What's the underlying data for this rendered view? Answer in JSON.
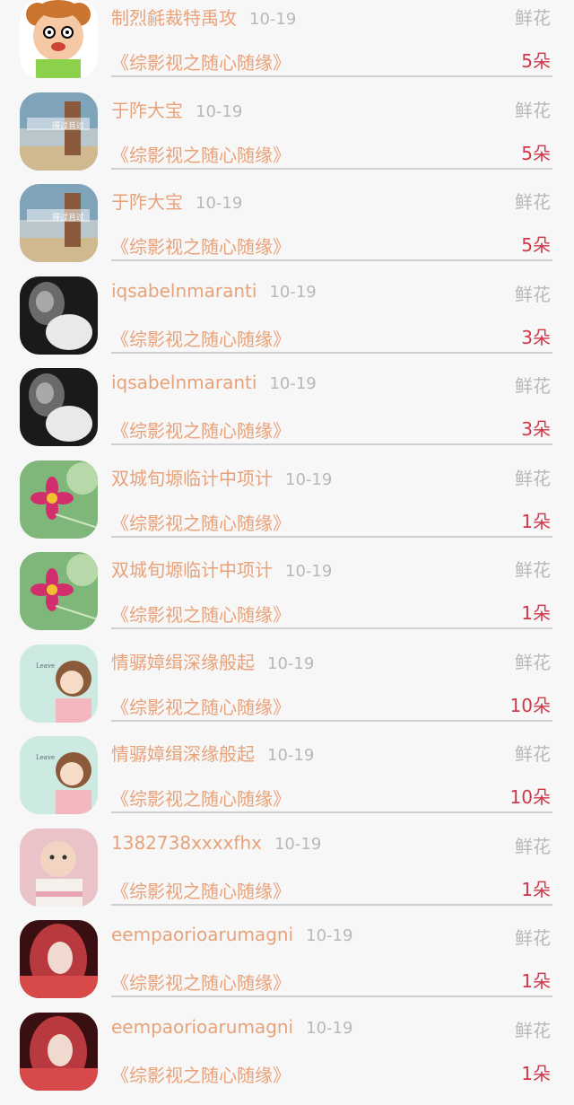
{
  "list": [
    {
      "username": "制烈毹裁特禹攻",
      "date": "10-19",
      "gift": "鲜花",
      "book": "《综影视之随心随缘》",
      "count": "5朵",
      "avatar": "cartoon-face-avatar"
    },
    {
      "username": "于阼大宝",
      "date": "10-19",
      "gift": "鲜花",
      "book": "《综影视之随心随缘》",
      "count": "5朵",
      "avatar": "beach-photo-avatar"
    },
    {
      "username": "于阼大宝",
      "date": "10-19",
      "gift": "鲜花",
      "book": "《综影视之随心随缘》",
      "count": "5朵",
      "avatar": "beach-photo-avatar"
    },
    {
      "username": "iqsabelnmaranti",
      "date": "10-19",
      "gift": "鲜花",
      "book": "《综影视之随心随缘》",
      "count": "3朵",
      "avatar": "bw-portrait-avatar"
    },
    {
      "username": "iqsabelnmaranti",
      "date": "10-19",
      "gift": "鲜花",
      "book": "《综影视之随心随缘》",
      "count": "3朵",
      "avatar": "bw-portrait-avatar"
    },
    {
      "username": "双城旬塬临计中项计",
      "date": "10-19",
      "gift": "鲜花",
      "book": "《综影视之随心随缘》",
      "count": "1朵",
      "avatar": "pink-flower-avatar"
    },
    {
      "username": "双城旬塬临计中项计",
      "date": "10-19",
      "gift": "鲜花",
      "book": "《综影视之随心随缘》",
      "count": "1朵",
      "avatar": "pink-flower-avatar"
    },
    {
      "username": "情骣嫜缉深缘般起",
      "date": "10-19",
      "gift": "鲜花",
      "book": "《综影视之随心随缘》",
      "count": "10朵",
      "avatar": "illustrated-girl-avatar"
    },
    {
      "username": "情骣嫜缉深缘般起",
      "date": "10-19",
      "gift": "鲜花",
      "book": "《综影视之随心随缘》",
      "count": "10朵",
      "avatar": "illustrated-girl-avatar"
    },
    {
      "username": "1382738xxxxfhx",
      "date": "10-19",
      "gift": "鲜花",
      "book": "《综影视之随心随缘》",
      "count": "1朵",
      "avatar": "baby-photo-avatar"
    },
    {
      "username": "eempaorioarumagni",
      "date": "10-19",
      "gift": "鲜花",
      "book": "《综影视之随心随缘》",
      "count": "1朵",
      "avatar": "red-hair-girl-avatar"
    },
    {
      "username": "eempaorioarumagni",
      "date": "10-19",
      "gift": "鲜花",
      "book": "《综影视之随心随缘》",
      "count": "1朵",
      "avatar": "red-hair-girl-avatar"
    }
  ],
  "colors": {
    "name": "#e8a27a",
    "date": "#b8b8b8",
    "count": "#d0374a",
    "background": "#f7f7f7"
  }
}
